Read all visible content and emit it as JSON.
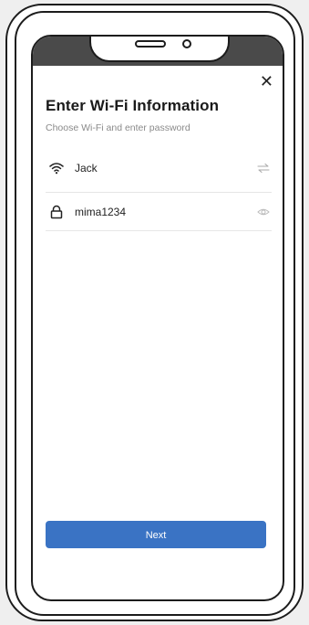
{
  "dialog": {
    "close_icon": "close-icon",
    "title": "Enter Wi-Fi Information",
    "subtitle": "Choose Wi-Fi and enter password"
  },
  "wifi": {
    "icon": "wifi-icon",
    "network_name": "Jack",
    "switch_icon": "swap-icon"
  },
  "password": {
    "icon": "lock-icon",
    "value": "mima1234",
    "visibility_icon": "eye-icon"
  },
  "actions": {
    "next_label": "Next"
  },
  "colors": {
    "accent": "#3a73c4",
    "title_text": "#1a1a1a",
    "subtitle_text": "#8a8a8a"
  }
}
